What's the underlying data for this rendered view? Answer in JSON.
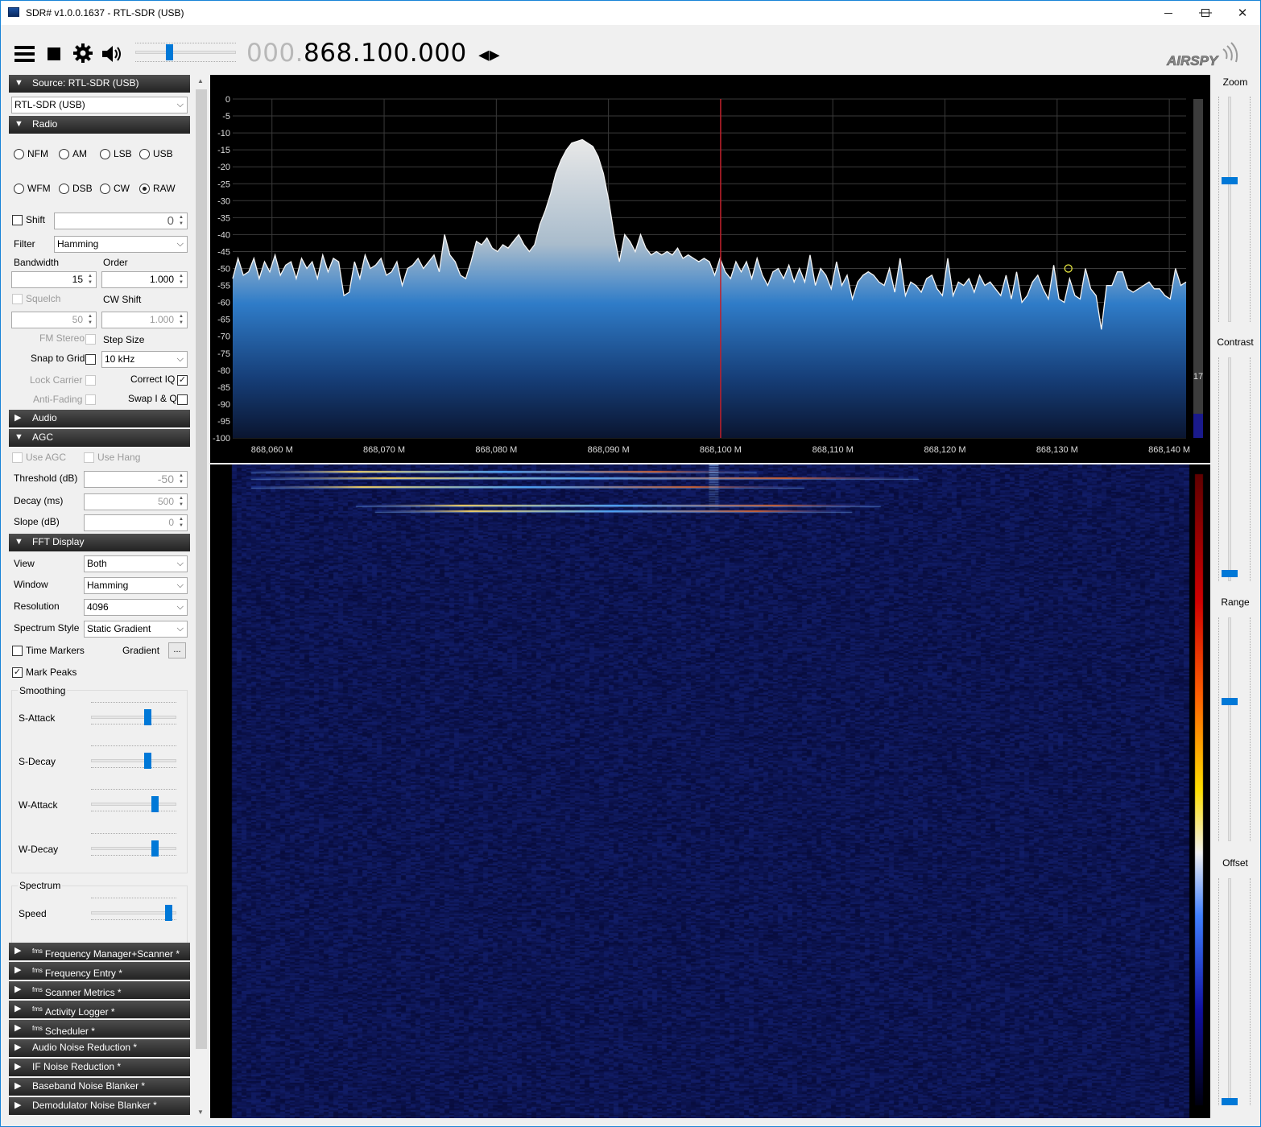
{
  "window": {
    "title": "SDR# v1.0.0.1637 - RTL-SDR (USB)",
    "minimize": "—",
    "maximize": "☐",
    "close": "✕"
  },
  "toolbar": {
    "freq_dim": "000.",
    "freq_main": "868.100.000",
    "freq_arrows": "◂▸",
    "volume_level": 0.33,
    "logo": "AIRSPY"
  },
  "source": {
    "header": "Source: RTL-SDR (USB)",
    "device": "RTL-SDR (USB)"
  },
  "radio": {
    "header": "Radio",
    "modes": [
      "NFM",
      "AM",
      "LSB",
      "USB",
      "WFM",
      "DSB",
      "CW",
      "RAW"
    ],
    "selected_mode": "RAW",
    "shift_label": "Shift",
    "shift_value": "0",
    "filter_label": "Filter",
    "filter_value": "Hamming",
    "bandwidth_label": "Bandwidth",
    "bandwidth_value": "15",
    "order_label": "Order",
    "order_value": "1.000",
    "squelch_label": "Squelch",
    "squelch_value": "50",
    "cwshift_label": "CW Shift",
    "cwshift_value": "1.000",
    "fmstereo_label": "FM Stereo",
    "stepsize_label": "Step Size",
    "snap_label": "Snap to Grid",
    "step_value": "10 kHz",
    "lockcarrier_label": "Lock Carrier",
    "correctiq_label": "Correct IQ",
    "antifading_label": "Anti-Fading",
    "swapiq_label": "Swap I & Q"
  },
  "audio": {
    "header": "Audio"
  },
  "agc": {
    "header": "AGC",
    "use_agc": "Use AGC",
    "use_hang": "Use Hang",
    "threshold_label": "Threshold (dB)",
    "threshold_value": "-50",
    "decay_label": "Decay (ms)",
    "decay_value": "500",
    "slope_label": "Slope (dB)",
    "slope_value": "0"
  },
  "fft": {
    "header": "FFT Display",
    "view_label": "View",
    "view_value": "Both",
    "window_label": "Window",
    "window_value": "Hamming",
    "resolution_label": "Resolution",
    "resolution_value": "4096",
    "style_label": "Spectrum Style",
    "style_value": "Static Gradient",
    "time_markers": "Time Markers",
    "gradient_label": "Gradient",
    "gradient_button": "...",
    "mark_peaks": "Mark Peaks",
    "smoothing_label": "Smoothing",
    "s_attack": "S-Attack",
    "s_decay": "S-Decay",
    "w_attack": "W-Attack",
    "w_decay": "W-Decay",
    "s_attack_level": 0.68,
    "s_decay_level": 0.68,
    "w_attack_level": 0.77,
    "w_decay_level": 0.77,
    "spectrum_label": "Spectrum",
    "speed_label": "Speed",
    "speed_level": 0.95
  },
  "plugins": [
    {
      "sup": "fms",
      "name": "Frequency Manager+Scanner *"
    },
    {
      "sup": "fms",
      "name": "Frequency Entry *"
    },
    {
      "sup": "fms",
      "name": "Scanner Metrics *"
    },
    {
      "sup": "fms",
      "name": "Activity Logger *"
    },
    {
      "sup": "fms",
      "name": "Scheduler *"
    },
    {
      "sup": "",
      "name": "Audio Noise Reduction *"
    },
    {
      "sup": "",
      "name": "IF Noise Reduction *"
    },
    {
      "sup": "",
      "name": "Baseband Noise Blanker *"
    },
    {
      "sup": "",
      "name": "Demodulator Noise Blanker *"
    }
  ],
  "right_panel": {
    "zoom": "Zoom",
    "contrast": "Contrast",
    "range": "Range",
    "offset": "Offset",
    "zoom_level": 0.63,
    "contrast_level": 0.02,
    "range_level": 0.63,
    "offset_level": 0.0
  },
  "spectrum": {
    "db_ticks": [
      "0",
      "-5",
      "-10",
      "-15",
      "-20",
      "-25",
      "-30",
      "-35",
      "-40",
      "-45",
      "-50",
      "-55",
      "-60",
      "-65",
      "-70",
      "-75",
      "-80",
      "-85",
      "-90",
      "-95",
      "-100"
    ],
    "freq_ticks": [
      "868,060 M",
      "868,070 M",
      "868,080 M",
      "868,090 M",
      "868,100 M",
      "868,110 M",
      "868,120 M",
      "868,130 M",
      "868,140 M"
    ],
    "center_freq_mhz": 868.1,
    "snr_value": "17",
    "snr_level": 0.17,
    "peak_marker_mhz": 868.131,
    "peak_marker_db": -50,
    "trace_db": [
      -53,
      -47,
      -52,
      -51,
      -47,
      -53,
      -48,
      -51,
      -46,
      -52,
      -49,
      -48,
      -53,
      -47,
      -50,
      -48,
      -53,
      -46,
      -51,
      -47,
      -48,
      -58,
      -57,
      -48,
      -53,
      -46,
      -50,
      -49,
      -47,
      -52,
      -51,
      -48,
      -55,
      -50,
      -49,
      -47,
      -50,
      -48,
      -46,
      -51,
      -40,
      -46,
      -48,
      -52,
      -53,
      -48,
      -42,
      -43,
      -41,
      -44,
      -45,
      -43,
      -44,
      -42,
      -40,
      -43,
      -45,
      -43,
      -37,
      -33,
      -28,
      -22,
      -18,
      -15,
      -13,
      -12.5,
      -12,
      -13,
      -14,
      -17,
      -22,
      -30,
      -40,
      -48,
      -40,
      -42,
      -45,
      -40,
      -44,
      -46,
      -45,
      -46,
      -45,
      -46,
      -44,
      -47,
      -46,
      -47,
      -48,
      -47,
      -48,
      -52,
      -47,
      -51,
      -53,
      -48,
      -51,
      -48,
      -53,
      -47,
      -52,
      -55,
      -51,
      -50,
      -53,
      -49,
      -54,
      -50,
      -54,
      -46,
      -55,
      -50,
      -52,
      -56,
      -48,
      -55,
      -52,
      -59,
      -54,
      -52,
      -51,
      -52,
      -54,
      -55,
      -50,
      -57,
      -47,
      -58,
      -54,
      -55,
      -57,
      -53,
      -52,
      -56,
      -58,
      -47,
      -58,
      -54,
      -55,
      -53,
      -57,
      -52,
      -55,
      -54,
      -56,
      -58,
      -52,
      -59,
      -51,
      -60,
      -58,
      -54,
      -52,
      -56,
      -59,
      -49,
      -59,
      -60,
      -53,
      -58,
      -59,
      -50,
      -56,
      -58,
      -68,
      -55,
      -55,
      -51,
      -51,
      -56,
      -57,
      -56,
      -55,
      -54,
      -56,
      -56,
      -58,
      -59,
      -50,
      -55,
      -54
    ],
    "trace_start_mhz": 868.0565,
    "trace_end_mhz": 868.1415
  },
  "waterfall": {
    "burst_rows": 4
  }
}
